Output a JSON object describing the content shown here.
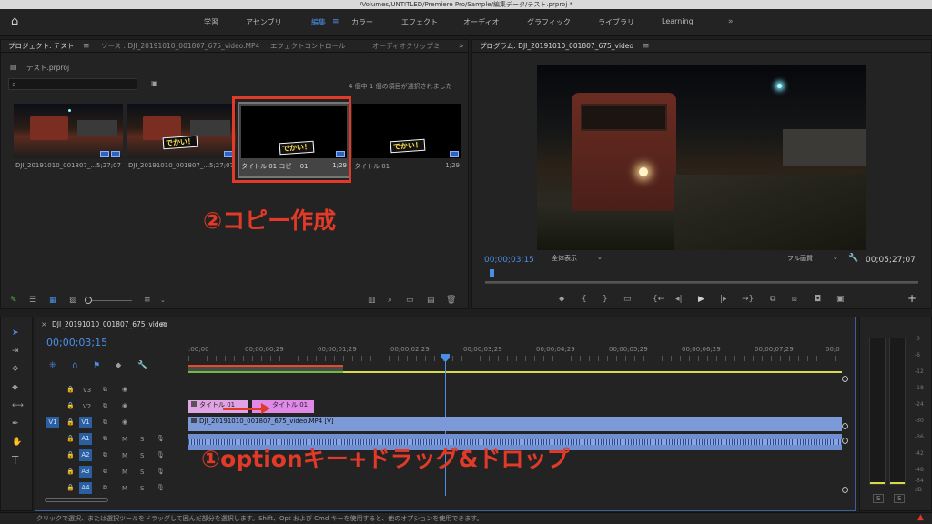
{
  "window": {
    "title": "/Volumes/UNTITLED/Premiere Pro/Sample/編集データ/テスト.prproj *"
  },
  "workspaces": [
    {
      "label": "学習"
    },
    {
      "label": "アセンブリ"
    },
    {
      "label": "編集"
    },
    {
      "label": "カラー"
    },
    {
      "label": "エフェクト"
    },
    {
      "label": "オーディオ"
    },
    {
      "label": "グラフィック"
    },
    {
      "label": "ライブラリ"
    },
    {
      "label": "Learning"
    }
  ],
  "project_panel": {
    "tabs": [
      "プロジェクト: テスト",
      "ソース : DJI_20191010_001807_675_video.MP4",
      "エフェクトコントロール",
      "オーディオクリップミ"
    ],
    "file_name": "テスト.prproj",
    "selection_status": "4 個中 1 個の項目が選択されました",
    "items": [
      {
        "name": "DJI_20191010_001807_...",
        "duration": "5;27;07"
      },
      {
        "name": "DJI_20191010_001807_...",
        "duration": "5;27;07"
      },
      {
        "name": "タイトル 01 コピー 01",
        "duration": "1;29"
      },
      {
        "name": "タイトル 01",
        "duration": "1;29"
      }
    ],
    "thumb_text": "でかい！"
  },
  "program_monitor": {
    "tab": "プログラム: DJI_20191010_001807_675_video",
    "timecode": "00;00;03;15",
    "zoom": "全体表示",
    "quality": "フル画質",
    "duration": "00;05;27;07",
    "playhead_fraction": 0.011
  },
  "timeline": {
    "tab": "DJI_20191010_001807_675_video",
    "timecode": "00;00;03;15",
    "ruler": [
      ":00;00",
      "00;00;00;29",
      "00;00;01;29",
      "00;00;02;29",
      "00;00;03;29",
      "00;00;04;29",
      "00;00;05;29",
      "00;00;06;29",
      "00;00;07;29",
      "00;0"
    ],
    "tracks": [
      {
        "id": "V3",
        "src": ""
      },
      {
        "id": "V2",
        "src": ""
      },
      {
        "id": "V1",
        "src": "V1"
      },
      {
        "id": "A1",
        "src": "A1",
        "m": "M",
        "s": "S"
      },
      {
        "id": "A2",
        "src": "",
        "m": "M",
        "s": "S"
      },
      {
        "id": "A3",
        "src": "",
        "m": "M",
        "s": "S"
      },
      {
        "id": "A4",
        "src": "",
        "m": "M",
        "s": "S"
      }
    ],
    "clips": {
      "title1": "タイトル 01",
      "title_drag": "タイトル 01",
      "video": "DJI_20191010_001807_675_video.MP4 [V]"
    }
  },
  "meter": {
    "labels": [
      "0",
      "-6",
      "-12",
      "-18",
      "-24",
      "-30",
      "-36",
      "-42",
      "-48",
      "-54",
      "dB"
    ],
    "solo": [
      "S",
      "S"
    ]
  },
  "annotations": {
    "step2": "②コピー作成",
    "step1": "①optionキー+ドラッグ&ドロップ",
    "accent": "#e23a28"
  },
  "status_bar": "クリックで選択、または選択ツールをドラッグして囲んだ部分を選択します。Shift、Opt および Cmd キーを使用すると、他のオプションを使用できます。"
}
